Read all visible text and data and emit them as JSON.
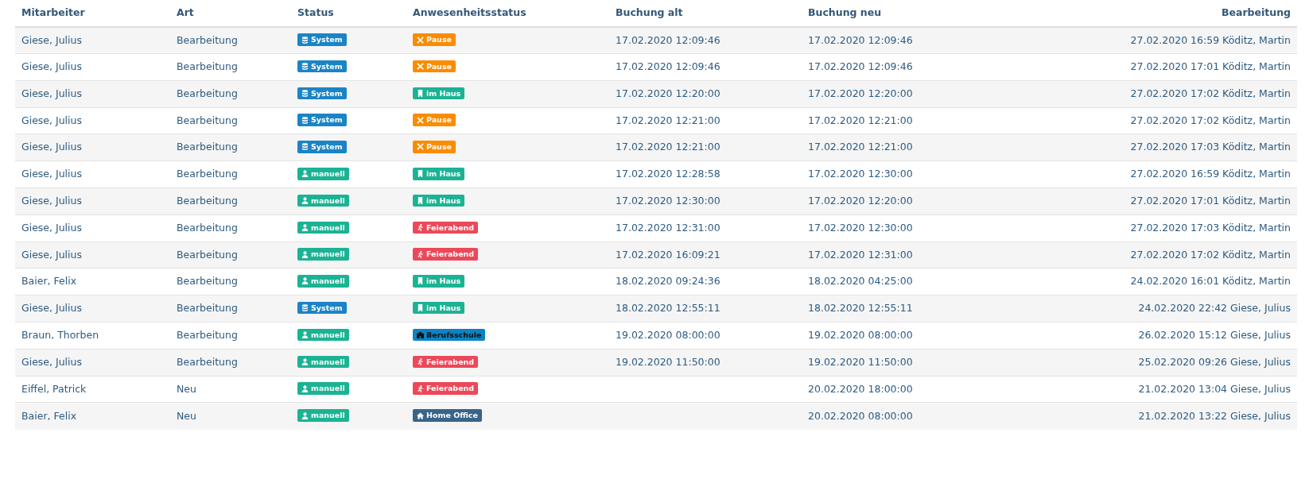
{
  "table": {
    "columns": [
      "Mitarbeiter",
      "Art",
      "Status",
      "Anwesenheitsstatus",
      "Buchung alt",
      "Buchung neu",
      "Bearbeitung"
    ],
    "rows": [
      {
        "mitarbeiter": "Giese, Julius",
        "art": "Bearbeitung",
        "status": {
          "kind": "system",
          "label": "System"
        },
        "anwesenheit": {
          "kind": "pause",
          "label": "Pause"
        },
        "buchung_alt": "17.02.2020 12:09:46",
        "buchung_neu": "17.02.2020 12:09:46",
        "bearbeitung": "27.02.2020 16:59 Köditz, Martin"
      },
      {
        "mitarbeiter": "Giese, Julius",
        "art": "Bearbeitung",
        "status": {
          "kind": "system",
          "label": "System"
        },
        "anwesenheit": {
          "kind": "pause",
          "label": "Pause"
        },
        "buchung_alt": "17.02.2020 12:09:46",
        "buchung_neu": "17.02.2020 12:09:46",
        "bearbeitung": "27.02.2020 17:01 Köditz, Martin"
      },
      {
        "mitarbeiter": "Giese, Julius",
        "art": "Bearbeitung",
        "status": {
          "kind": "system",
          "label": "System"
        },
        "anwesenheit": {
          "kind": "im_haus",
          "label": "im Haus"
        },
        "buchung_alt": "17.02.2020 12:20:00",
        "buchung_neu": "17.02.2020 12:20:00",
        "bearbeitung": "27.02.2020 17:02 Köditz, Martin"
      },
      {
        "mitarbeiter": "Giese, Julius",
        "art": "Bearbeitung",
        "status": {
          "kind": "system",
          "label": "System"
        },
        "anwesenheit": {
          "kind": "pause",
          "label": "Pause"
        },
        "buchung_alt": "17.02.2020 12:21:00",
        "buchung_neu": "17.02.2020 12:21:00",
        "bearbeitung": "27.02.2020 17:02 Köditz, Martin"
      },
      {
        "mitarbeiter": "Giese, Julius",
        "art": "Bearbeitung",
        "status": {
          "kind": "system",
          "label": "System"
        },
        "anwesenheit": {
          "kind": "pause",
          "label": "Pause"
        },
        "buchung_alt": "17.02.2020 12:21:00",
        "buchung_neu": "17.02.2020 12:21:00",
        "bearbeitung": "27.02.2020 17:03 Köditz, Martin"
      },
      {
        "mitarbeiter": "Giese, Julius",
        "art": "Bearbeitung",
        "status": {
          "kind": "manuell",
          "label": "manuell"
        },
        "anwesenheit": {
          "kind": "im_haus",
          "label": "im Haus"
        },
        "buchung_alt": "17.02.2020 12:28:58",
        "buchung_neu": "17.02.2020 12:30:00",
        "bearbeitung": "27.02.2020 16:59 Köditz, Martin"
      },
      {
        "mitarbeiter": "Giese, Julius",
        "art": "Bearbeitung",
        "status": {
          "kind": "manuell",
          "label": "manuell"
        },
        "anwesenheit": {
          "kind": "im_haus",
          "label": "im Haus"
        },
        "buchung_alt": "17.02.2020 12:30:00",
        "buchung_neu": "17.02.2020 12:20:00",
        "bearbeitung": "27.02.2020 17:01 Köditz, Martin"
      },
      {
        "mitarbeiter": "Giese, Julius",
        "art": "Bearbeitung",
        "status": {
          "kind": "manuell",
          "label": "manuell"
        },
        "anwesenheit": {
          "kind": "feierabend",
          "label": "Feierabend"
        },
        "buchung_alt": "17.02.2020 12:31:00",
        "buchung_neu": "17.02.2020 12:30:00",
        "bearbeitung": "27.02.2020 17:03 Köditz, Martin"
      },
      {
        "mitarbeiter": "Giese, Julius",
        "art": "Bearbeitung",
        "status": {
          "kind": "manuell",
          "label": "manuell"
        },
        "anwesenheit": {
          "kind": "feierabend",
          "label": "Feierabend"
        },
        "buchung_alt": "17.02.2020 16:09:21",
        "buchung_neu": "17.02.2020 12:31:00",
        "bearbeitung": "27.02.2020 17:02 Köditz, Martin"
      },
      {
        "mitarbeiter": "Baier, Felix",
        "art": "Bearbeitung",
        "status": {
          "kind": "manuell",
          "label": "manuell"
        },
        "anwesenheit": {
          "kind": "im_haus",
          "label": "im Haus"
        },
        "buchung_alt": "18.02.2020 09:24:36",
        "buchung_neu": "18.02.2020 04:25:00",
        "bearbeitung": "24.02.2020 16:01 Köditz, Martin"
      },
      {
        "mitarbeiter": "Giese, Julius",
        "art": "Bearbeitung",
        "status": {
          "kind": "system",
          "label": "System"
        },
        "anwesenheit": {
          "kind": "im_haus",
          "label": "im Haus"
        },
        "buchung_alt": "18.02.2020 12:55:11",
        "buchung_neu": "18.02.2020 12:55:11",
        "bearbeitung": "24.02.2020 22:42 Giese, Julius"
      },
      {
        "mitarbeiter": "Braun, Thorben",
        "art": "Bearbeitung",
        "status": {
          "kind": "manuell",
          "label": "manuell"
        },
        "anwesenheit": {
          "kind": "berufsschule",
          "label": "Berufsschule"
        },
        "buchung_alt": "19.02.2020 08:00:00",
        "buchung_neu": "19.02.2020 08:00:00",
        "bearbeitung": "26.02.2020 15:12 Giese, Julius"
      },
      {
        "mitarbeiter": "Giese, Julius",
        "art": "Bearbeitung",
        "status": {
          "kind": "manuell",
          "label": "manuell"
        },
        "anwesenheit": {
          "kind": "feierabend",
          "label": "Feierabend"
        },
        "buchung_alt": "19.02.2020 11:50:00",
        "buchung_neu": "19.02.2020 11:50:00",
        "bearbeitung": "25.02.2020 09:26 Giese, Julius"
      },
      {
        "mitarbeiter": "Eiffel, Patrick",
        "art": "Neu",
        "status": {
          "kind": "manuell",
          "label": "manuell"
        },
        "anwesenheit": {
          "kind": "feierabend",
          "label": "Feierabend"
        },
        "buchung_neu": "20.02.2020 18:00:00",
        "bearbeitung": "21.02.2020 13:04 Giese, Julius"
      },
      {
        "mitarbeiter": "Baier, Felix",
        "art": "Neu",
        "status": {
          "kind": "manuell",
          "label": "manuell"
        },
        "anwesenheit": {
          "kind": "home_office",
          "label": "Home Office"
        },
        "buchung_neu": "20.02.2020 08:00:00",
        "bearbeitung": "21.02.2020 13:22 Giese, Julius"
      }
    ]
  }
}
